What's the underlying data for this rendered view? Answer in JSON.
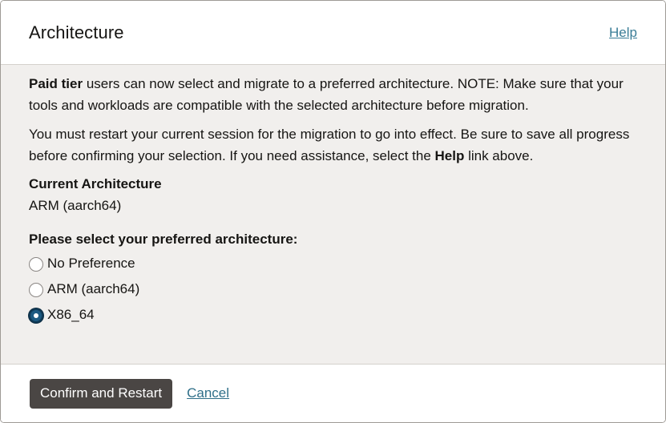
{
  "dialog": {
    "title": "Architecture",
    "help_label": "Help"
  },
  "body": {
    "para1_bold": "Paid tier",
    "para1_text": " users can now select and migrate to a preferred architecture. NOTE: Make sure that your tools and workloads are compatible with the selected architecture before migration.",
    "para2_text_a": "You must restart your current session for the migration to go into effect. Be sure to save all progress before confirming your selection. If you need assistance, select the ",
    "para2_bold": "Help",
    "para2_text_b": " link above.",
    "current_label": "Current Architecture",
    "current_value": "ARM (aarch64)",
    "select_label": "Please select your preferred architecture:",
    "options": [
      {
        "label": "No Preference",
        "checked": false
      },
      {
        "label": "ARM (aarch64)",
        "checked": false
      },
      {
        "label": "X86_64",
        "checked": true
      }
    ]
  },
  "footer": {
    "confirm_label": "Confirm and Restart",
    "cancel_label": "Cancel"
  }
}
